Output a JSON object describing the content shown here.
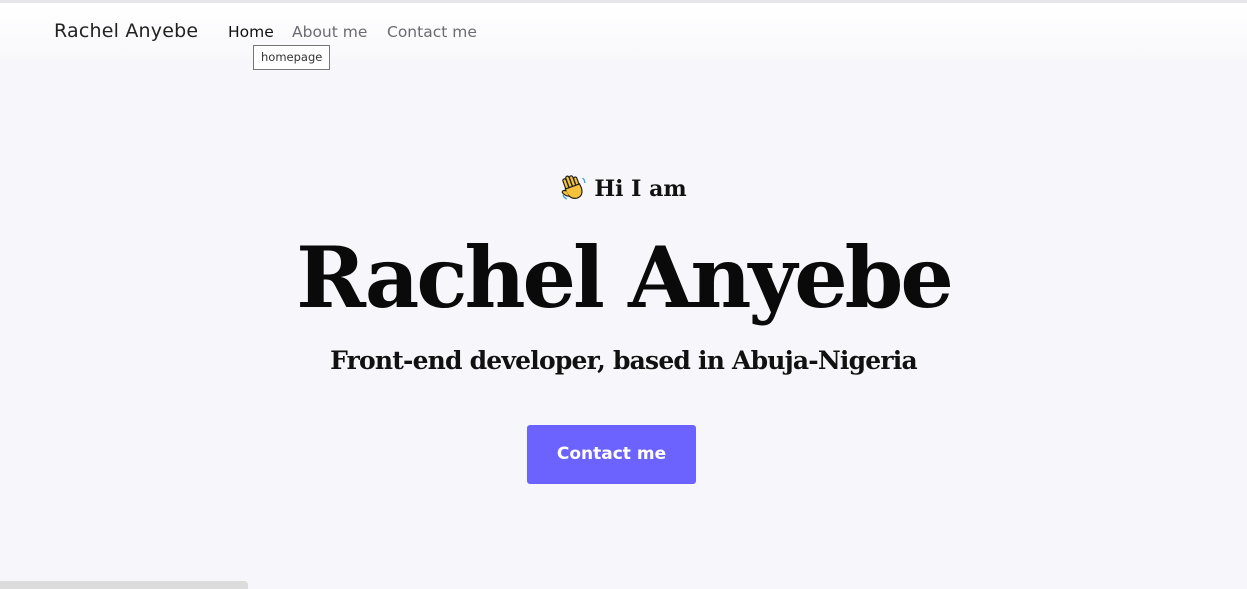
{
  "nav": {
    "brand": "Rachel Anyebe",
    "links": [
      {
        "label": "Home"
      },
      {
        "label": "About me"
      },
      {
        "label": "Contact me"
      }
    ],
    "tooltip": "homepage"
  },
  "hero": {
    "greeting_icon": "waving-hand-icon",
    "greeting": "Hi I am",
    "name": "Rachel Anyebe",
    "tagline": "Front-end developer, based in Abuja-Nigeria",
    "cta_label": "Contact me"
  },
  "colors": {
    "accent": "#6c63ff",
    "background": "#f7f7fb",
    "text": "#111111"
  }
}
